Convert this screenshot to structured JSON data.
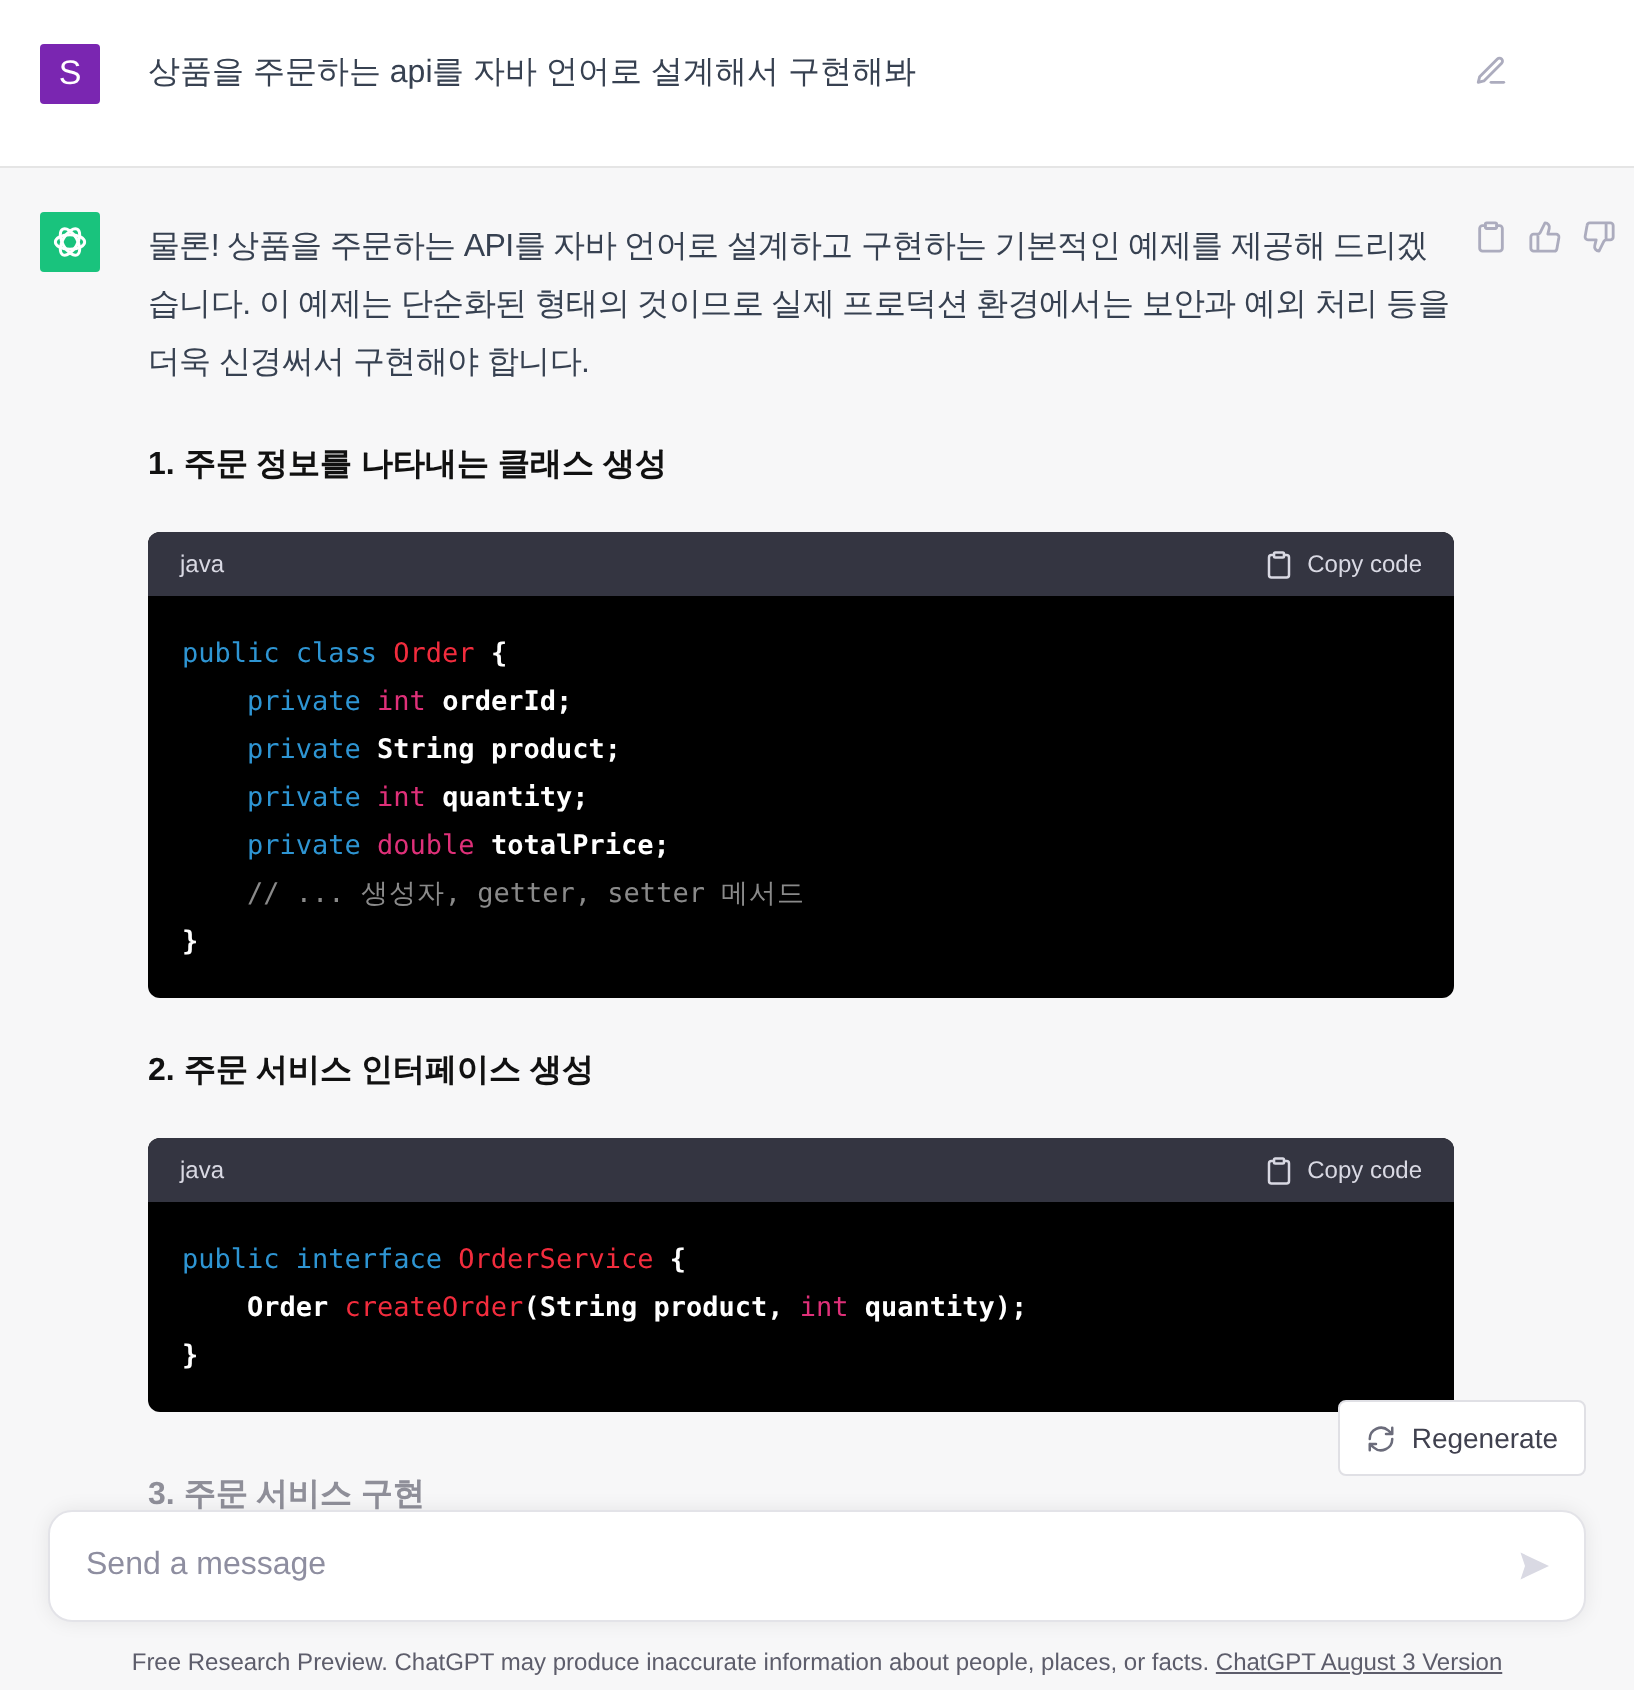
{
  "user_message": {
    "avatar_letter": "S",
    "text": "상품을 주문하는 api를 자바 언어로 설계해서 구현해봐"
  },
  "assistant_message": {
    "intro": "물론! 상품을 주문하는 API를 자바 언어로 설계하고 구현하는 기본적인 예제를 제공해 드리겠습니다. 이 예제는 단순화된 형태의 것이므로 실제 프로덕션 환경에서는 보안과 예외 처리 등을 더욱 신경써서 구현해야 합니다.",
    "sections": [
      {
        "heading": "1. 주문 정보를 나타내는 클래스 생성",
        "code": {
          "language": "java",
          "copy_label": "Copy code",
          "lines": [
            [
              {
                "kind": "keyword",
                "text": "public class "
              },
              {
                "kind": "title",
                "text": "Order"
              },
              {
                "kind": "plain",
                "text": " {"
              }
            ],
            [
              {
                "kind": "keyword",
                "text": "    private "
              },
              {
                "kind": "type",
                "text": "int"
              },
              {
                "kind": "plain",
                "text": " orderId;"
              }
            ],
            [
              {
                "kind": "keyword",
                "text": "    private "
              },
              {
                "kind": "plain",
                "text": "String product;"
              }
            ],
            [
              {
                "kind": "keyword",
                "text": "    private "
              },
              {
                "kind": "type",
                "text": "int"
              },
              {
                "kind": "plain",
                "text": " quantity;"
              }
            ],
            [
              {
                "kind": "keyword",
                "text": "    private "
              },
              {
                "kind": "type",
                "text": "double"
              },
              {
                "kind": "plain",
                "text": " totalPrice;"
              }
            ],
            [
              {
                "kind": "comment",
                "text": "    // ... 생성자, getter, setter 메서드"
              }
            ],
            [
              {
                "kind": "plain",
                "text": "}"
              }
            ]
          ]
        }
      },
      {
        "heading": "2. 주문 서비스 인터페이스 생성",
        "code": {
          "language": "java",
          "copy_label": "Copy code",
          "lines": [
            [
              {
                "kind": "keyword",
                "text": "public interface "
              },
              {
                "kind": "title",
                "text": "OrderService"
              },
              {
                "kind": "plain",
                "text": " {"
              }
            ],
            [
              {
                "kind": "plain",
                "text": "    Order "
              },
              {
                "kind": "title",
                "text": "createOrder"
              },
              {
                "kind": "plain",
                "text": "(String product, "
              },
              {
                "kind": "type",
                "text": "int"
              },
              {
                "kind": "plain",
                "text": " quantity);"
              }
            ],
            [
              {
                "kind": "plain",
                "text": "}"
              }
            ]
          ]
        }
      },
      {
        "heading": "3. 주문 서비스 구현"
      }
    ]
  },
  "regenerate_button": "Regenerate",
  "composer": {
    "placeholder": "Send a message"
  },
  "footer": {
    "text": "Free Research Preview. ChatGPT may produce inaccurate information about people, places, or facts.",
    "link": "ChatGPT August 3 Version"
  }
}
